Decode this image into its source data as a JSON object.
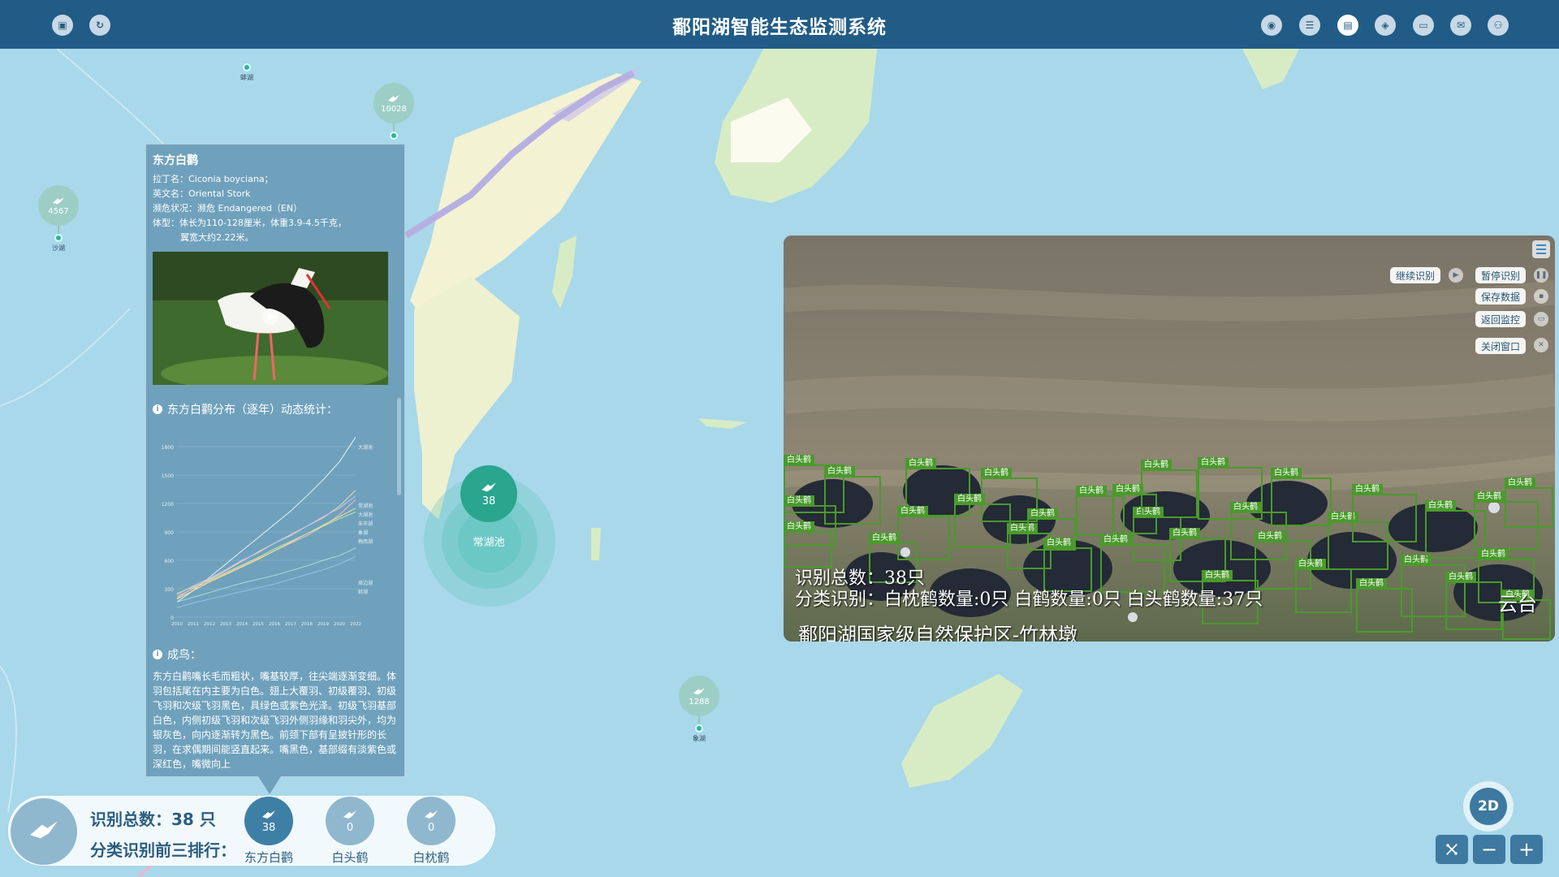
{
  "app": {
    "title": "鄱阳湖智能生态监测系统"
  },
  "map": {
    "markers": [
      {
        "count": "10028",
        "name": ""
      },
      {
        "count": "4567",
        "name": "沙湖"
      },
      {
        "count": "1288",
        "name": "象湖"
      },
      {
        "count": "",
        "name": "蚌湖"
      }
    ],
    "highlight": {
      "count": "38",
      "name": "常湖池"
    }
  },
  "info_panel": {
    "title": "东方白鹳",
    "latin": "拉丁名：Ciconia boyciana；",
    "english": "英文名：Oriental Stork",
    "status": "濒危状况：濒危 Endangered（EN）",
    "body1": "体型：体长为110-128厘米，体重3.9-4.5千克，",
    "body2": "翼宽大约2.22米。",
    "chart_heading": "东方白鹳分布（逐年）动态统计：",
    "adult_heading": "成鸟：",
    "adult_text": "东方白鹳嘴长毛而粗状，嘴基较厚，往尖端逐渐变细。体羽包括尾在内主要为白色。翅上大覆羽、初级覆羽、初级飞羽和次级飞羽黑色，具绿色或紫色光泽。初级飞羽基部白色，内侧初级飞羽和次级飞羽外侧羽缘和羽尖外，均为银灰色，向内逐渐转为黑色。前颈下部有呈披针形的长羽，在求偶期间能竖直起来。嘴黑色，基部缀有淡紫色或深红色，嘴微向上"
  },
  "chart_data": {
    "type": "line",
    "title": "",
    "x": [
      "2010",
      "2011",
      "2012",
      "2013",
      "2014",
      "2015",
      "2016",
      "2017",
      "2018",
      "2019",
      "2020",
      "2022"
    ],
    "ylim": [
      0,
      1800
    ],
    "yticks": [
      "0",
      "300",
      "600",
      "900",
      "1200",
      "1500",
      "1800"
    ],
    "series": [
      {
        "name": "大湖池",
        "color": "#dff3f9",
        "values": [
          160,
          280,
          420,
          560,
          700,
          840,
          980,
          1120,
          1280,
          1450,
          1640,
          1900
        ]
      },
      {
        "name": "常湖池",
        "color": "#f5d7a8",
        "values": [
          200,
          310,
          400,
          490,
          590,
          690,
          780,
          870,
          960,
          1050,
          1170,
          1340
        ]
      },
      {
        "name": "大湖池",
        "color": "#c9c2ef",
        "values": [
          240,
          330,
          410,
          500,
          600,
          680,
          780,
          860,
          960,
          1060,
          1150,
          1280
        ]
      },
      {
        "name": "朱市湖",
        "color": "#f3b3c8",
        "values": [
          220,
          300,
          380,
          460,
          540,
          620,
          700,
          780,
          860,
          960,
          1080,
          1240
        ]
      },
      {
        "name": "象湖",
        "color": "#f4e58d",
        "values": [
          190,
          280,
          370,
          450,
          530,
          610,
          700,
          790,
          880,
          970,
          1060,
          1150
        ]
      },
      {
        "name": "梅西湖",
        "color": "#bfe6a1",
        "values": [
          250,
          320,
          390,
          470,
          550,
          630,
          720,
          800,
          880,
          960,
          1040,
          1110
        ]
      },
      {
        "name": "周边湖",
        "color": "#a7e3d6",
        "values": [
          160,
          210,
          260,
          310,
          360,
          400,
          440,
          490,
          540,
          600,
          650,
          730
        ]
      },
      {
        "name": "蚌湖",
        "color": "#93c7e4",
        "values": [
          100,
          150,
          190,
          230,
          270,
          310,
          350,
          400,
          450,
          500,
          560,
          640
        ]
      }
    ]
  },
  "stats": {
    "total": "识别总数：38 只",
    "rank_label": "分类识别前三排行：",
    "ranks": [
      {
        "label": "东方白鹳",
        "count": "38"
      },
      {
        "label": "白头鹤",
        "count": "0"
      },
      {
        "label": "白枕鹤",
        "count": "0"
      }
    ]
  },
  "video": {
    "buttons": {
      "resume": "继续识别",
      "pause": "暂停识别",
      "save": "保存数据",
      "back": "返回监控",
      "close": "关闭窗口"
    },
    "detection_label": "白头鹤",
    "overlay_total": "识别总数：38只",
    "overlay_class": "分类识别：白枕鹤数量:0只 白鹤数量:0只   白头鹤数量:37只",
    "overlay_location": "鄱阳湖国家级自然保护区-竹林墩",
    "overlay_brand": "云台"
  },
  "controls": {
    "mode": "2D",
    "zoom_out": "−",
    "zoom_in": "+"
  },
  "colors": {
    "topbar": "#205c86",
    "panel": "#6798b5",
    "accent": "#2aa58e",
    "water": "#a8d8ea",
    "land": "#f3f2d3"
  }
}
